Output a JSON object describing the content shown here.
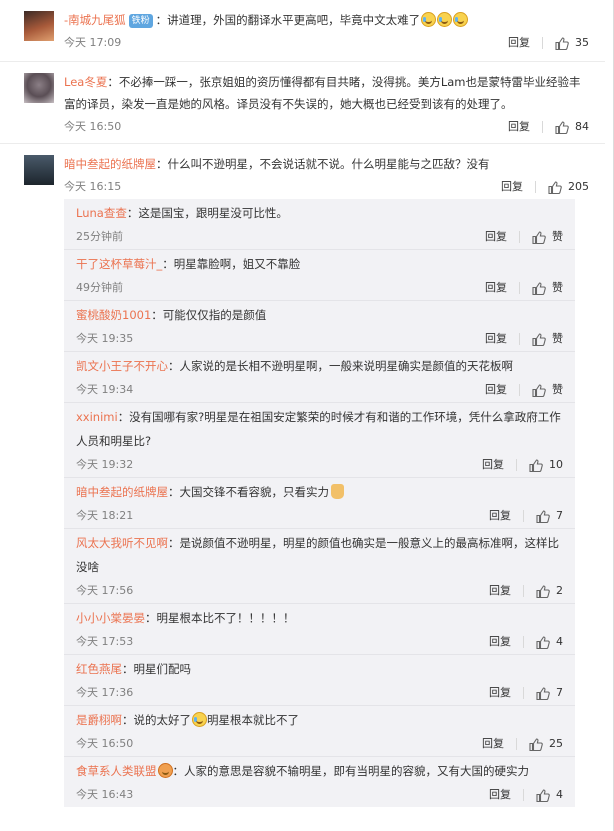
{
  "common": {
    "reply_label": "回复",
    "like_zan": "赞"
  },
  "comments": [
    {
      "user": "-南城九尾狐",
      "badge": "铁粉",
      "text": "：讲道理，外国的翻译水平更高吧，毕竟中文太难了",
      "time": "今天 17:09",
      "likes": "35",
      "emoji": "cry-laugh"
    },
    {
      "user": "Lea冬夏",
      "text": "：不必捧一踩一，张京姐姐的资历懂得都有目共睹，没得挑。美方Lam也是蒙特雷毕业经验丰富的译员，染发一直是她的风格。译员没有不失误的，她大概也已经受到该有的处理了。",
      "time": "今天 16:50",
      "likes": "84"
    },
    {
      "user": "暗中叁起的纸牌屋",
      "text": "：什么叫不逊明星，不会说话就不说。什么明星能与之匹敌？没有",
      "time": "今天 16:15",
      "likes": "205"
    }
  ],
  "replies": [
    {
      "user": "Luna查查",
      "text": "：这是国宝，跟明星没可比性。",
      "time": "25分钟前",
      "likes": "赞"
    },
    {
      "user": "干了这杯草莓汁_",
      "text": "：明星靠脸啊，姐又不靠脸",
      "time": "49分钟前",
      "likes": "赞"
    },
    {
      "user": "蜜桃酸奶1001",
      "text": "：可能仅仅指的是颜值",
      "time": "今天 19:35",
      "likes": "赞"
    },
    {
      "user": "凯文小王子不开心",
      "text": "：人家说的是长相不逊明星啊，一般来说明星确实是颜值的天花板啊",
      "time": "今天 19:34",
      "likes": "赞"
    },
    {
      "user": "xxinimi",
      "text": "：没有国哪有家?明星是在祖国安定繁荣的时候才有和谐的工作环境，凭什么拿政府工作人员和明星比?",
      "time": "今天 19:32",
      "likes": "10"
    },
    {
      "user": "暗中叁起的纸牌屋",
      "text": "：大国交锋不看容貌，只看实力",
      "time": "今天 18:21",
      "likes": "7"
    },
    {
      "user": "风太大我听不见啊",
      "text": "：是说颜值不逊明星，明星的颜值也确实是一般意义上的最高标准啊，这样比没啥",
      "time": "今天 17:56",
      "likes": "2"
    },
    {
      "user": "小小小棠晏晏",
      "text": "：明星根本比不了！！！！！",
      "time": "今天 17:53",
      "likes": "4"
    },
    {
      "user": "红色燕尾",
      "text": "：明星们配吗",
      "time": "今天 17:36",
      "likes": "7"
    },
    {
      "user": "是爵栩啊",
      "text": "：说的太好了",
      "text2": "明星根本就比不了",
      "time": "今天 16:50",
      "likes": "25"
    },
    {
      "user": "食草系人类联盟",
      "text": "：人家的意思是容貌不输明星，即有当明星的容貌，又有大国的硬实力",
      "time": "今天 16:43",
      "likes": "4"
    }
  ]
}
